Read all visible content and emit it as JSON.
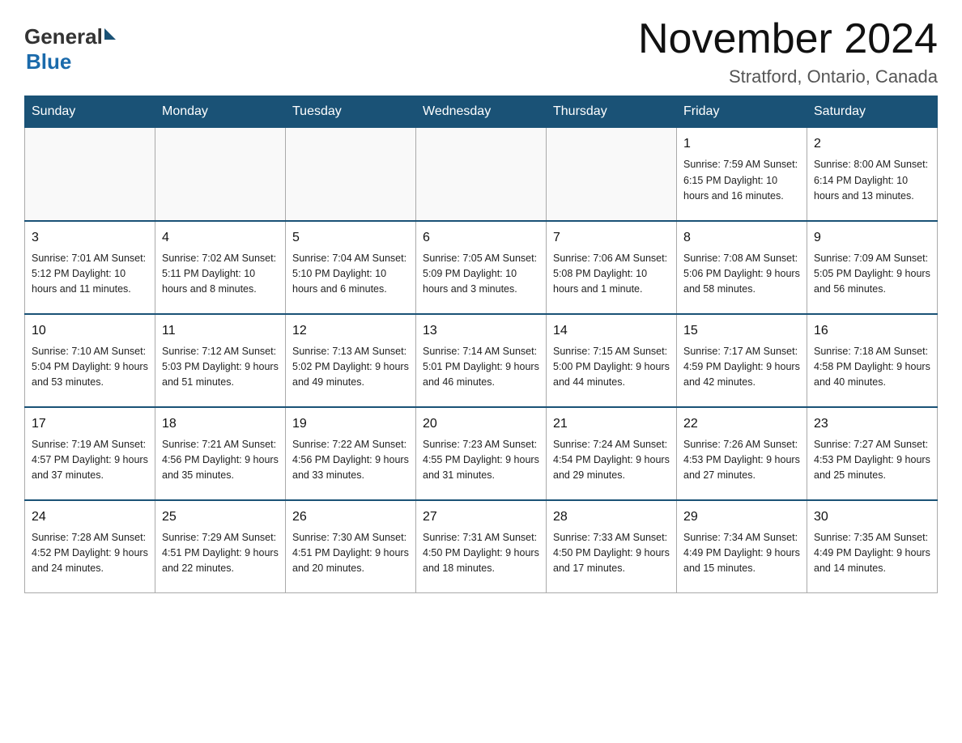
{
  "header": {
    "logo_general": "General",
    "logo_blue": "Blue",
    "month_title": "November 2024",
    "location": "Stratford, Ontario, Canada"
  },
  "weekdays": [
    "Sunday",
    "Monday",
    "Tuesday",
    "Wednesday",
    "Thursday",
    "Friday",
    "Saturday"
  ],
  "weeks": [
    [
      {
        "day": "",
        "info": ""
      },
      {
        "day": "",
        "info": ""
      },
      {
        "day": "",
        "info": ""
      },
      {
        "day": "",
        "info": ""
      },
      {
        "day": "",
        "info": ""
      },
      {
        "day": "1",
        "info": "Sunrise: 7:59 AM\nSunset: 6:15 PM\nDaylight: 10 hours\nand 16 minutes."
      },
      {
        "day": "2",
        "info": "Sunrise: 8:00 AM\nSunset: 6:14 PM\nDaylight: 10 hours\nand 13 minutes."
      }
    ],
    [
      {
        "day": "3",
        "info": "Sunrise: 7:01 AM\nSunset: 5:12 PM\nDaylight: 10 hours\nand 11 minutes."
      },
      {
        "day": "4",
        "info": "Sunrise: 7:02 AM\nSunset: 5:11 PM\nDaylight: 10 hours\nand 8 minutes."
      },
      {
        "day": "5",
        "info": "Sunrise: 7:04 AM\nSunset: 5:10 PM\nDaylight: 10 hours\nand 6 minutes."
      },
      {
        "day": "6",
        "info": "Sunrise: 7:05 AM\nSunset: 5:09 PM\nDaylight: 10 hours\nand 3 minutes."
      },
      {
        "day": "7",
        "info": "Sunrise: 7:06 AM\nSunset: 5:08 PM\nDaylight: 10 hours\nand 1 minute."
      },
      {
        "day": "8",
        "info": "Sunrise: 7:08 AM\nSunset: 5:06 PM\nDaylight: 9 hours\nand 58 minutes."
      },
      {
        "day": "9",
        "info": "Sunrise: 7:09 AM\nSunset: 5:05 PM\nDaylight: 9 hours\nand 56 minutes."
      }
    ],
    [
      {
        "day": "10",
        "info": "Sunrise: 7:10 AM\nSunset: 5:04 PM\nDaylight: 9 hours\nand 53 minutes."
      },
      {
        "day": "11",
        "info": "Sunrise: 7:12 AM\nSunset: 5:03 PM\nDaylight: 9 hours\nand 51 minutes."
      },
      {
        "day": "12",
        "info": "Sunrise: 7:13 AM\nSunset: 5:02 PM\nDaylight: 9 hours\nand 49 minutes."
      },
      {
        "day": "13",
        "info": "Sunrise: 7:14 AM\nSunset: 5:01 PM\nDaylight: 9 hours\nand 46 minutes."
      },
      {
        "day": "14",
        "info": "Sunrise: 7:15 AM\nSunset: 5:00 PM\nDaylight: 9 hours\nand 44 minutes."
      },
      {
        "day": "15",
        "info": "Sunrise: 7:17 AM\nSunset: 4:59 PM\nDaylight: 9 hours\nand 42 minutes."
      },
      {
        "day": "16",
        "info": "Sunrise: 7:18 AM\nSunset: 4:58 PM\nDaylight: 9 hours\nand 40 minutes."
      }
    ],
    [
      {
        "day": "17",
        "info": "Sunrise: 7:19 AM\nSunset: 4:57 PM\nDaylight: 9 hours\nand 37 minutes."
      },
      {
        "day": "18",
        "info": "Sunrise: 7:21 AM\nSunset: 4:56 PM\nDaylight: 9 hours\nand 35 minutes."
      },
      {
        "day": "19",
        "info": "Sunrise: 7:22 AM\nSunset: 4:56 PM\nDaylight: 9 hours\nand 33 minutes."
      },
      {
        "day": "20",
        "info": "Sunrise: 7:23 AM\nSunset: 4:55 PM\nDaylight: 9 hours\nand 31 minutes."
      },
      {
        "day": "21",
        "info": "Sunrise: 7:24 AM\nSunset: 4:54 PM\nDaylight: 9 hours\nand 29 minutes."
      },
      {
        "day": "22",
        "info": "Sunrise: 7:26 AM\nSunset: 4:53 PM\nDaylight: 9 hours\nand 27 minutes."
      },
      {
        "day": "23",
        "info": "Sunrise: 7:27 AM\nSunset: 4:53 PM\nDaylight: 9 hours\nand 25 minutes."
      }
    ],
    [
      {
        "day": "24",
        "info": "Sunrise: 7:28 AM\nSunset: 4:52 PM\nDaylight: 9 hours\nand 24 minutes."
      },
      {
        "day": "25",
        "info": "Sunrise: 7:29 AM\nSunset: 4:51 PM\nDaylight: 9 hours\nand 22 minutes."
      },
      {
        "day": "26",
        "info": "Sunrise: 7:30 AM\nSunset: 4:51 PM\nDaylight: 9 hours\nand 20 minutes."
      },
      {
        "day": "27",
        "info": "Sunrise: 7:31 AM\nSunset: 4:50 PM\nDaylight: 9 hours\nand 18 minutes."
      },
      {
        "day": "28",
        "info": "Sunrise: 7:33 AM\nSunset: 4:50 PM\nDaylight: 9 hours\nand 17 minutes."
      },
      {
        "day": "29",
        "info": "Sunrise: 7:34 AM\nSunset: 4:49 PM\nDaylight: 9 hours\nand 15 minutes."
      },
      {
        "day": "30",
        "info": "Sunrise: 7:35 AM\nSunset: 4:49 PM\nDaylight: 9 hours\nand 14 minutes."
      }
    ]
  ]
}
